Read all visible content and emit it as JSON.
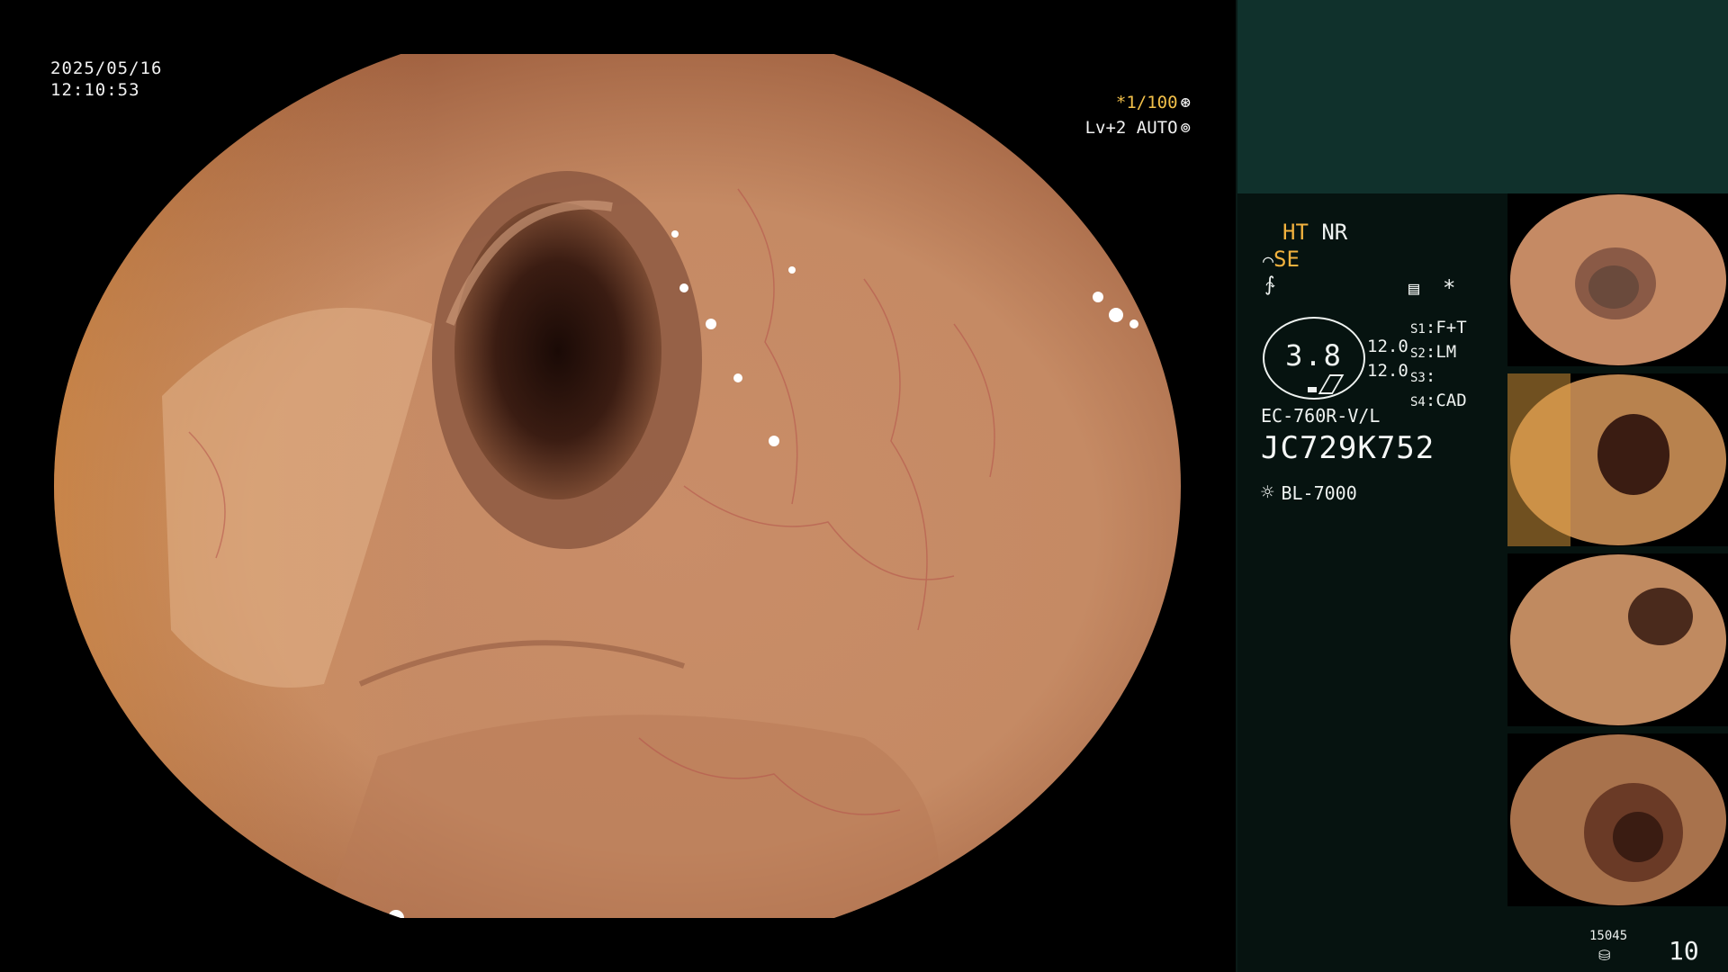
{
  "overlay": {
    "date": "2025/05/16",
    "time": "12:10:53",
    "shutter": "*1/100",
    "shutter_icon": "aperture-icon",
    "level": "Lv+2 AUTO",
    "level_icon": "iris-icon"
  },
  "panel": {
    "ht": "HT",
    "nr": "NR",
    "se": "SE",
    "se_icon": "structure-enhance-icon",
    "wave_icon": "wave-icon",
    "grid_icon": "grid-icon",
    "star": "*",
    "dial_value": "3.8",
    "dial_nums": [
      "12.0",
      "12.0"
    ],
    "s_labels": [
      "S1",
      "S2",
      "S3",
      "S4"
    ],
    "s_values": [
      "F+T",
      "LM",
      "",
      "CAD"
    ],
    "scope_model": "EC-760R-V/L",
    "scope_serial": "JC729K752",
    "light_source_icon": "lamp-icon",
    "light_source": "BL-7000"
  },
  "footer": {
    "count": "15045",
    "db_icon": "database-icon",
    "number": "10"
  },
  "colors": {
    "panel_bg": "#061310",
    "panel_top": "#10312c",
    "amber": "#f2b23e"
  }
}
